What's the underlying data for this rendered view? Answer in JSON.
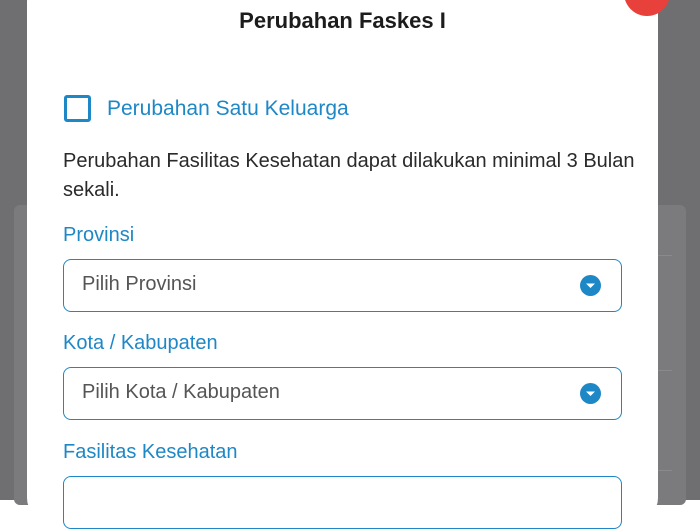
{
  "modal": {
    "title": "Perubahan Faskes I"
  },
  "family_change": {
    "label": "Perubahan Satu Keluarga",
    "checked": false
  },
  "info_text": "Perubahan Fasilitas Kesehatan dapat dilakukan minimal 3 Bulan sekali.",
  "fields": {
    "provinsi": {
      "label": "Provinsi",
      "placeholder": "Pilih Provinsi"
    },
    "kota": {
      "label": "Kota / Kabupaten",
      "placeholder": "Pilih Kota / Kabupaten"
    },
    "faskes": {
      "label": "Fasilitas Kesehatan",
      "placeholder": ""
    }
  },
  "colors": {
    "accent": "#1e87c6",
    "close": "#e8403a",
    "overlay": "#6f6f71"
  },
  "icons": {
    "dropdown": "chevron-down-circle-icon",
    "close": "close-icon"
  }
}
